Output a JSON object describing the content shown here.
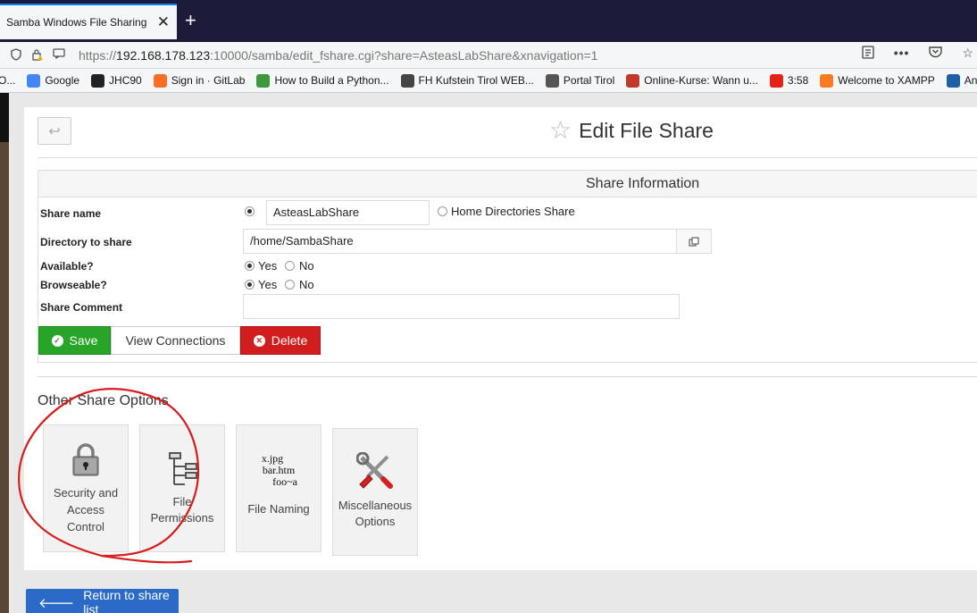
{
  "browser": {
    "tab_title": "Samba Windows File Sharing —",
    "tab_close": "✕",
    "new_tab": "+",
    "url_prefix": "https://",
    "url_host": "192.168.178.123",
    "url_rest": ":10000/samba/edit_fshare.cgi?share=AsteasLabShare&xnavigation=1",
    "bookmarks": [
      {
        "label": "O...",
        "icon": "truncated-icon",
        "color": "#888888"
      },
      {
        "label": "Google",
        "icon": "google-icon",
        "color": "#4285f4"
      },
      {
        "label": "JHC90",
        "icon": "github-icon",
        "color": "#222222"
      },
      {
        "label": "Sign in · GitLab",
        "icon": "gitlab-icon",
        "color": "#fc6d26"
      },
      {
        "label": "How to Build a Python...",
        "icon": "leaf-icon",
        "color": "#3c9a3c"
      },
      {
        "label": "FH Kufstein Tirol WEB...",
        "icon": "globe-icon",
        "color": "#444444"
      },
      {
        "label": "Portal Tirol",
        "icon": "portal-icon",
        "color": "#555555"
      },
      {
        "label": "Online-Kurse: Wann u...",
        "icon": "udemy-icon",
        "color": "#c0392b"
      },
      {
        "label": "3:58",
        "icon": "youtube-icon",
        "color": "#e62117"
      },
      {
        "label": "Welcome to XAMPP",
        "icon": "xampp-icon",
        "color": "#fb7a24"
      },
      {
        "label": "Anmeld",
        "icon": "oth-icon",
        "color": "#1f5fa8"
      }
    ]
  },
  "page": {
    "title": "Edit File Share",
    "section_header": "Share Information",
    "labels": {
      "share_name": "Share name",
      "directory": "Directory to share",
      "available": "Available?",
      "browseable": "Browseable?",
      "comment": "Share Comment"
    },
    "share_name_value": "AsteasLabShare",
    "home_dirs_label": "Home Directories Share",
    "directory_value": "/home/SambaShare",
    "comment_value": "",
    "yes": "Yes",
    "no": "No",
    "available": "Yes",
    "browseable": "Yes",
    "buttons": {
      "save": "Save",
      "view_connections": "View Connections",
      "delete": "Delete"
    },
    "other_options_title": "Other Share Options",
    "options": [
      {
        "line1": "Security and",
        "line2": "Access",
        "line3": "Control"
      },
      {
        "line1": "File",
        "line2": "Permissions"
      },
      {
        "line1": "File Naming"
      },
      {
        "line1": "Miscellaneous",
        "line2": "Options"
      }
    ],
    "naming_icon_text": [
      "x.jpg",
      "bar.htm",
      "foo~a"
    ],
    "return_label": "Return to share list"
  }
}
